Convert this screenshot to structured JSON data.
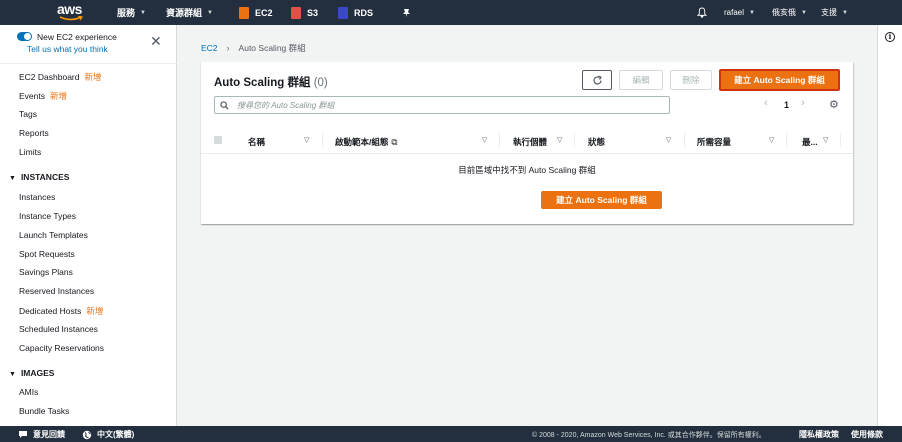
{
  "nav": {
    "logo": "aws",
    "services": "服務",
    "resource_groups": "資源群組",
    "shortcuts": [
      {
        "label": "EC2",
        "color": "#ec7211"
      },
      {
        "label": "S3",
        "color": "#e05243"
      },
      {
        "label": "RDS",
        "color": "#3b48cc"
      }
    ],
    "pin_icon": "pin-icon",
    "bell_icon": "bell-icon",
    "user": "rafael",
    "region": "俄亥俄",
    "support": "支援"
  },
  "sidebar": {
    "toggle_title": "New EC2 experience",
    "toggle_link": "Tell us what you think",
    "new_tag": "新增",
    "top_items": [
      {
        "label": "EC2 Dashboard",
        "is_new": true
      },
      {
        "label": "Events",
        "is_new": true
      },
      {
        "label": "Tags",
        "is_new": false
      },
      {
        "label": "Reports",
        "is_new": false
      },
      {
        "label": "Limits",
        "is_new": false
      }
    ],
    "instances_section": "INSTANCES",
    "instances_items": [
      {
        "label": "Instances",
        "is_new": false
      },
      {
        "label": "Instance Types",
        "is_new": false
      },
      {
        "label": "Launch Templates",
        "is_new": false
      },
      {
        "label": "Spot Requests",
        "is_new": false
      },
      {
        "label": "Savings Plans",
        "is_new": false
      },
      {
        "label": "Reserved Instances",
        "is_new": false
      },
      {
        "label": "Dedicated Hosts",
        "is_new": true
      },
      {
        "label": "Scheduled Instances",
        "is_new": false
      },
      {
        "label": "Capacity Reservations",
        "is_new": false
      }
    ],
    "images_section": "IMAGES",
    "images_items": [
      {
        "label": "AMIs"
      },
      {
        "label": "Bundle Tasks"
      }
    ]
  },
  "breadcrumb": {
    "root": "EC2",
    "current": "Auto Scaling 群組"
  },
  "card": {
    "title": "Auto Scaling 群組",
    "count": "(0)",
    "edit_label": "編輯",
    "delete_label": "刪除",
    "create_label": "建立 Auto Scaling 群組",
    "search_placeholder": "搜尋您的 Auto Scaling 群組",
    "page": "1",
    "columns": [
      {
        "label": "名稱"
      },
      {
        "label": "啟動範本/組態"
      },
      {
        "label": "執行個體"
      },
      {
        "label": "狀態"
      },
      {
        "label": "所需容量"
      },
      {
        "label": "最..."
      }
    ],
    "empty_text": "目前區域中找不到 Auto Scaling 群組",
    "empty_create_label": "建立 Auto Scaling 群組"
  },
  "footer": {
    "feedback": "意見回饋",
    "language": "中文(繁體)",
    "copyright": "© 2008 - 2020, Amazon Web Services, Inc. 或其合作夥伴。保留所有權利。",
    "privacy": "隱私權政策",
    "terms": "使用條款"
  },
  "colors": {
    "nav_bg": "#232f3e",
    "accent": "#ec7211",
    "link": "#0073bb"
  }
}
